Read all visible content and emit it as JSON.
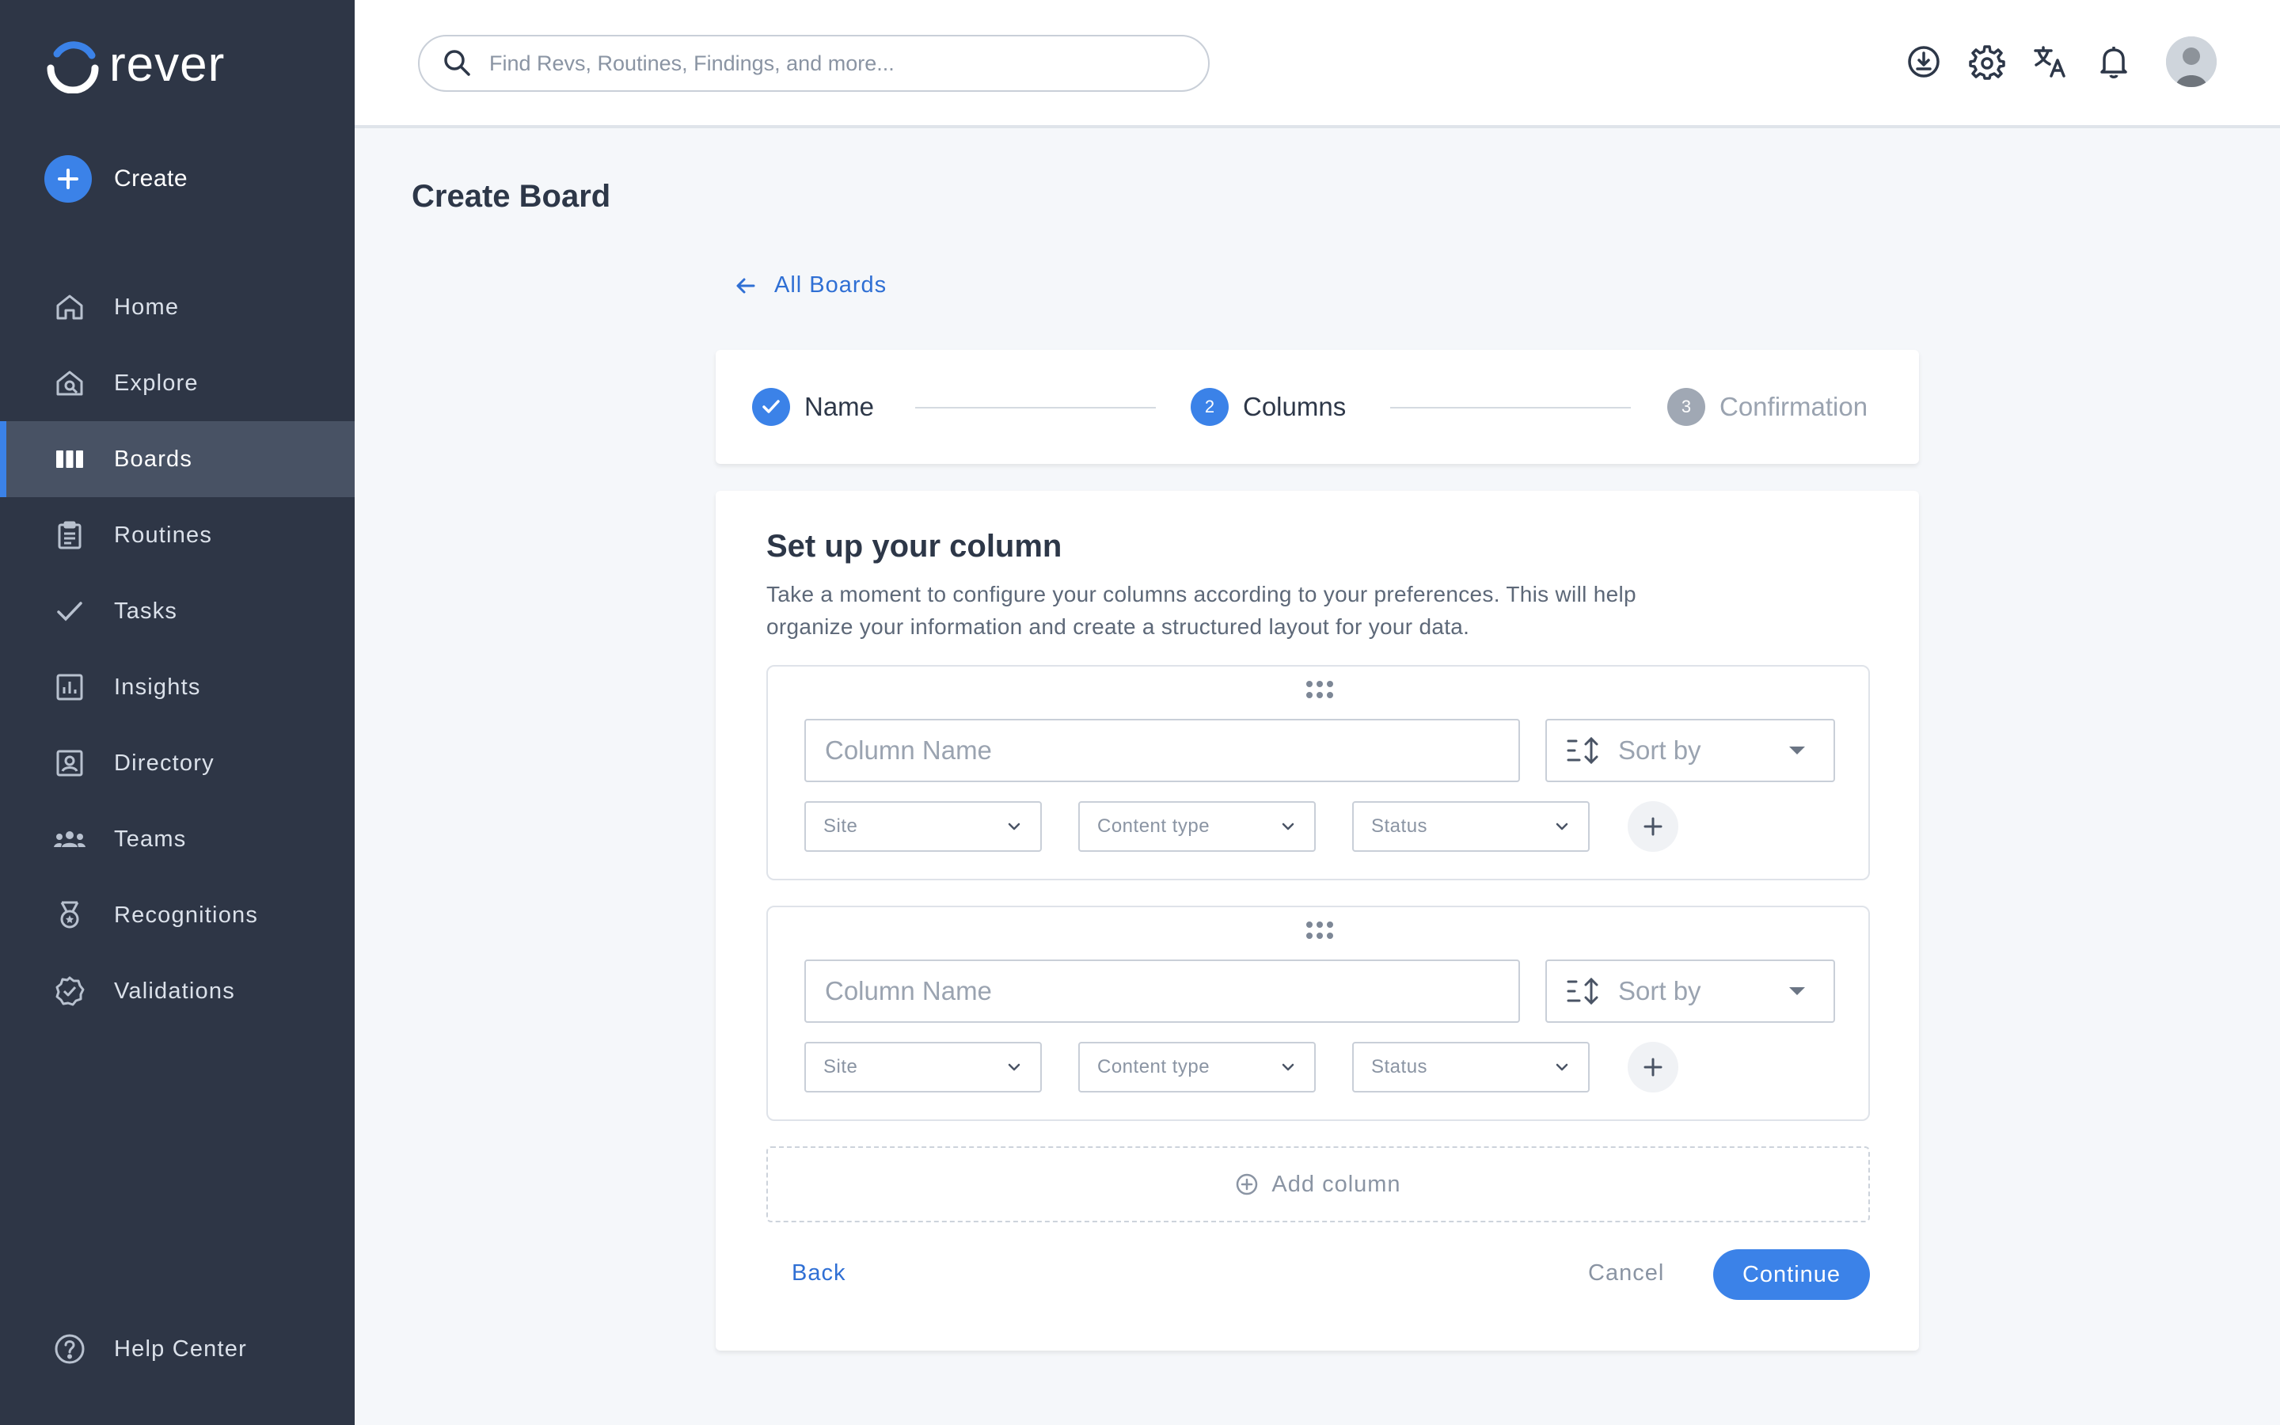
{
  "brand": {
    "name": "rever",
    "accent": "#3b82e8"
  },
  "sidebar": {
    "create_label": "Create",
    "items": [
      {
        "label": "Home",
        "icon": "home-icon"
      },
      {
        "label": "Explore",
        "icon": "explore-icon"
      },
      {
        "label": "Boards",
        "icon": "boards-icon",
        "active": true
      },
      {
        "label": "Routines",
        "icon": "clipboard-icon"
      },
      {
        "label": "Tasks",
        "icon": "check-icon"
      },
      {
        "label": "Insights",
        "icon": "chart-icon"
      },
      {
        "label": "Directory",
        "icon": "contact-icon"
      },
      {
        "label": "Teams",
        "icon": "people-icon"
      },
      {
        "label": "Recognitions",
        "icon": "medal-icon"
      },
      {
        "label": "Validations",
        "icon": "badge-check-icon"
      }
    ],
    "help_label": "Help Center"
  },
  "header": {
    "search_placeholder": "Find Revs, Routines, Findings, and more...",
    "icons": [
      "download-icon",
      "gear-icon",
      "translate-icon",
      "bell-icon",
      "avatar"
    ]
  },
  "page": {
    "title": "Create Board",
    "back_label": "All Boards"
  },
  "stepper": {
    "steps": [
      {
        "label": "Name",
        "state": "done"
      },
      {
        "number": "2",
        "label": "Columns",
        "state": "current"
      },
      {
        "number": "3",
        "label": "Confirmation",
        "state": "upcoming"
      }
    ]
  },
  "form": {
    "title": "Set up your column",
    "description": "Take a moment to configure your columns according to your preferences. This will help organize your information and create a structured layout for your data.",
    "columns": [
      {
        "name_placeholder": "Column Name",
        "sort_label": "Sort by",
        "filters": [
          "Site",
          "Content type",
          "Status"
        ]
      },
      {
        "name_placeholder": "Column Name",
        "sort_label": "Sort by",
        "filters": [
          "Site",
          "Content type",
          "Status"
        ]
      }
    ],
    "add_column_label": "Add column",
    "back_label": "Back",
    "cancel_label": "Cancel",
    "continue_label": "Continue"
  }
}
